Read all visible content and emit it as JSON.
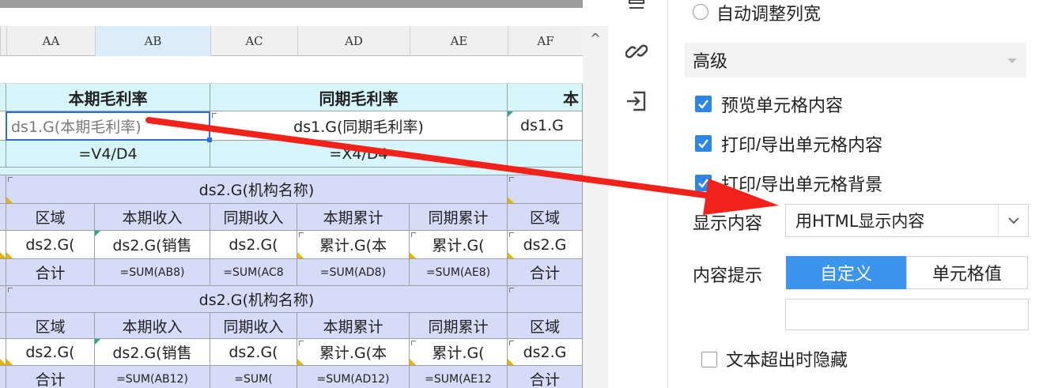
{
  "columns": [
    "AA",
    "AB",
    "AC",
    "AD",
    "AE",
    "AF"
  ],
  "header_row": {
    "current_margin": "本期毛利率",
    "prior_margin": "同期毛利率",
    "partial": "本"
  },
  "field_row": {
    "ab": "ds1.G(本期毛利率)",
    "ad": "ds1.G(同期毛利率)",
    "af": "ds1.G"
  },
  "formula_row": {
    "ab": "=V4/D4",
    "ad": "=X4/D4"
  },
  "group1": {
    "title": "ds2.G(机构名称)",
    "headers": [
      "区域",
      "本期收入",
      "同期收入",
      "本期累计",
      "同期累计",
      "区域"
    ],
    "fields": [
      "ds2.G(",
      "ds2.G(销售",
      "ds2.G(",
      "累计.G(本",
      "累计.G(",
      "ds2.G"
    ],
    "totals": [
      "合计",
      "=SUM(AB8)",
      "=SUM(AC8",
      "=SUM(AD8)",
      "=SUM(AE8)",
      "合计"
    ]
  },
  "group2": {
    "title": "ds2.G(机构名称)",
    "headers": [
      "区域",
      "本期收入",
      "同期收入",
      "本期累计",
      "同期累计",
      "区域"
    ],
    "fields": [
      "ds2.G(",
      "ds2.G(销售",
      "ds2.G(",
      "累计.G(本",
      "累计.G(",
      "ds2.G"
    ],
    "totals": [
      "合计",
      "=SUM(AB12)",
      "=SUM(",
      "=SUM(AD12)",
      "=SUM(AE12",
      "合计"
    ]
  },
  "scroll_up_glyph": "^",
  "panel": {
    "auto_col_width": "自动调整列宽",
    "advanced": "高级",
    "preview_content": "预览单元格内容",
    "print_export_content": "打印/导出单元格内容",
    "print_export_bg": "打印/导出单元格背景",
    "display_content_label": "显示内容",
    "display_content_value": "用HTML显示内容",
    "content_tip_label": "内容提示",
    "tip_custom": "自定义",
    "tip_cell_value": "单元格值",
    "tip_input_value": "",
    "hide_overflow": "文本超出时隐藏"
  },
  "checks": {
    "preview": true,
    "print_content": true,
    "print_bg": true,
    "hide_overflow": false,
    "auto_width": false
  },
  "colors": {
    "accent": "#3d94ec",
    "header_cyan": "#d6f6fb",
    "group_lavender": "#d6dcf8",
    "arrow": "#f2221a"
  },
  "icons": [
    "collapse-icon",
    "link-icon",
    "import-icon",
    "chevron-down-icon",
    "checkmark-icon"
  ]
}
